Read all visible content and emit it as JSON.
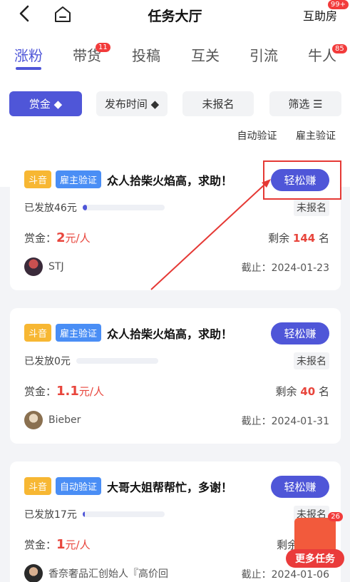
{
  "header": {
    "title": "任务大厅",
    "right_label": "互助房",
    "right_badge": "99+"
  },
  "tabs": [
    {
      "label": "涨粉",
      "active": true
    },
    {
      "label": "带货",
      "badge": "11"
    },
    {
      "label": "投稿"
    },
    {
      "label": "互关"
    },
    {
      "label": "引流"
    },
    {
      "label": "牛人",
      "badge": "85"
    }
  ],
  "filters": {
    "reward": "赏金 ◆",
    "publish_time": "发布时间 ◆",
    "unregistered": "未报名",
    "filter": "筛选 ☰",
    "auto_verify": "自动验证",
    "owner_verify": "雇主验证"
  },
  "tasks": [
    {
      "platform": "斗音",
      "verify": "雇主验证",
      "title": "众人拾柴火焰高，求助！",
      "button": "轻松赚",
      "paid_label": "已发放",
      "paid": "46元",
      "paid_fraction": 0.05,
      "status": "未报名",
      "reward_label": "赏金：",
      "reward": "2",
      "reward_unit": "元/人",
      "remain_label": "剩余",
      "remain": "144",
      "remain_unit": "名",
      "user": "STJ",
      "deadline": "截止：2024-01-23"
    },
    {
      "platform": "斗音",
      "verify": "雇主验证",
      "title": "众人拾柴火焰高，求助！",
      "button": "轻松赚",
      "paid_label": "已发放",
      "paid": "0元",
      "paid_fraction": 0,
      "status": "未报名",
      "reward_label": "赏金：",
      "reward": "1.1",
      "reward_unit": "元/人",
      "remain_label": "剩余",
      "remain": "40",
      "remain_unit": "名",
      "user": "Bieber",
      "deadline": "截止：2024-01-31"
    },
    {
      "platform": "斗音",
      "verify": "自动验证",
      "title": "大哥大姐帮帮忙，多谢！",
      "button": "轻松赚",
      "paid_label": "已发放",
      "paid": "17元",
      "paid_fraction": 0.02,
      "status": "未报名",
      "reward_label": "赏金：",
      "reward": "1",
      "reward_unit": "元/人",
      "remain_label": "剩余",
      "remain": "",
      "remain_unit": "",
      "user": "香奈奢品汇创始人『高价回",
      "deadline": "截止：2024-01-06"
    }
  ],
  "floating": {
    "label": "更多任务",
    "badge": "26"
  }
}
